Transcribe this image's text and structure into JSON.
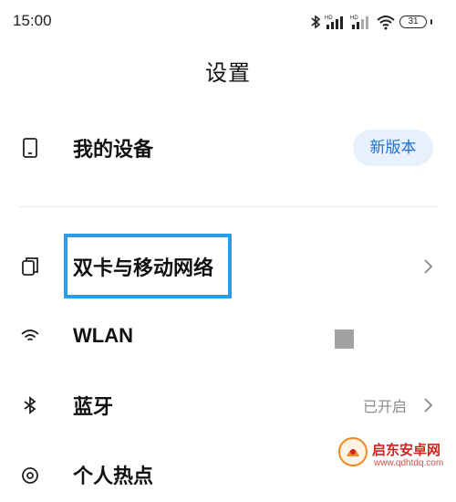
{
  "status_bar": {
    "time": "15:00",
    "icons": [
      "bluetooth-icon",
      "hd-signal-icon",
      "hd-signal-icon",
      "wifi-icon"
    ],
    "battery_level": "31"
  },
  "page": {
    "title": "设置"
  },
  "rows": [
    {
      "icon": "phone-icon",
      "label": "我的设备",
      "badge": "新版本"
    },
    {
      "icon": "dual-sim-icon",
      "label": "双卡与移动网络"
    },
    {
      "icon": "wifi-icon",
      "label": "WLAN"
    },
    {
      "icon": "bluetooth-icon",
      "label": "蓝牙",
      "status": "已开启"
    },
    {
      "icon": "hotspot-icon",
      "label": "个人热点"
    }
  ],
  "watermark": {
    "name": "启东安卓网",
    "url": "www.qdhtdq.com"
  },
  "colors": {
    "accent": "#1f6fd6",
    "badge_bg": "#e7f1fc",
    "highlight": "#2c9be8"
  }
}
